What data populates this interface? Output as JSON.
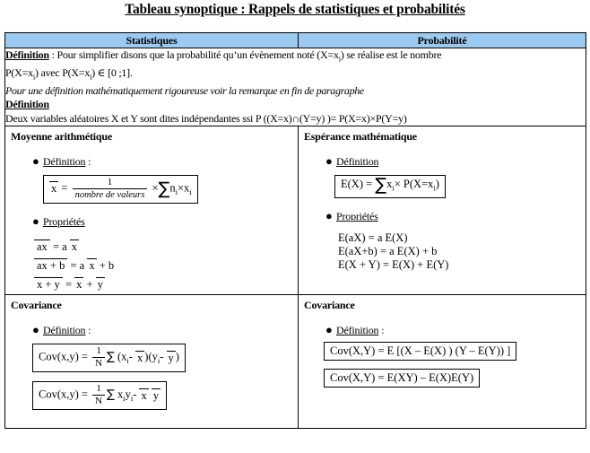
{
  "title": "Tableau synoptique : Rappels de statistiques et probabilités",
  "header": {
    "left": "Statistiques",
    "right": "Probabilité"
  },
  "definition_block": {
    "label_1": "Définition",
    "label_1_sep": " : ",
    "line_1": "Pour simplifier disons que la probabilité qu’un évènement noté (X=x",
    "line_1_sub": "i",
    "line_1_end": ") se réalise est le nombre",
    "line_2_a": "P(X=x",
    "line_2_sub1": "i",
    "line_2_b": ") avec P(X=x",
    "line_2_sub2": "i",
    "line_2_c": ") ∈ [0 ;1].",
    "remark": "Pour une définition mathématiquement rigoureuse voir la remarque en fin de paragraphe",
    "label_2": "Définition",
    "line_3": "Deux variables aléatoires X et Y sont dites indépendantes ssi P ((X=x)∩(Y=y) )= P(X=x)×P(Y=y)"
  },
  "sections": {
    "mean": {
      "heading": "Moyenne arithmétique",
      "bullet_definition": "Définition",
      "bullet_definition_colon": " :",
      "bullet_properties": "Propriétés",
      "formula": {
        "lhs": "x",
        "eq": "=",
        "num": "1",
        "den": "nombre de valeurs",
        "times": "×",
        "sigma": "∑",
        "tail_n": "n",
        "tail_n_sub": "i",
        "tail_times": "×",
        "tail_x": "x",
        "tail_x_sub": "i"
      },
      "properties": [
        {
          "bar_lhs": "ax",
          "eq": "= a",
          "bar_rhs": "x",
          "tail": ""
        },
        {
          "bar_lhs": "ax + b",
          "eq": "= a",
          "bar_rhs": "x",
          "tail": "+ b"
        },
        {
          "bar_lhs": "x + y",
          "eq": "=",
          "bar_rhs": "x",
          "tail": "",
          "bar_rhs2": "y",
          "plus": "+"
        }
      ]
    },
    "expectation": {
      "heading": "Espérance mathématique",
      "bullet_definition": "Définition",
      "bullet_properties": "Propriétés",
      "formula": {
        "lhs": "E(X) =",
        "sigma": "∑",
        "x": "x",
        "x_sub": "i",
        "times": "×",
        "prob": "P(X=x",
        "prob_sub": "i",
        "prob_end": ")"
      },
      "properties": [
        "E(aX) = a E(X)",
        "E(aX+b) = a E(X) + b",
        "E(X + Y) = E(X) + E(Y)"
      ]
    },
    "covariance_left": {
      "heading": "Covariance",
      "bullet_definition": "Définition",
      "bullet_definition_colon": " :",
      "formula_1": {
        "lhs": "Cov(x,y) =",
        "num": "1",
        "den": "N",
        "sigma": "∑",
        "open": "(x",
        "x_sub": "i",
        "minus1": "-",
        "bar_x": "x",
        "mid": ")(y",
        "y_sub": "i",
        "minus2": "-",
        "bar_y": "y",
        "close": ")"
      },
      "formula_2": {
        "lhs": "Cov(x,y) =",
        "num": "1",
        "den": "N",
        "sigma": "∑",
        "terms": "x",
        "terms_sub1": "i",
        "terms_y": "y",
        "terms_sub2": "i",
        "minus": "-",
        "bar_x": "x",
        "bar_y": "y"
      }
    },
    "covariance_right": {
      "heading": "Covariance",
      "bullet_definition": "Définition",
      "bullet_definition_colon": " :",
      "formula_1": "Cov(X,Y) = E [(X – E(X) ) (Y – E(Y)) ]",
      "formula_2": "Cov(X,Y) = E(XY) – E(X)E(Y)"
    }
  },
  "colors": {
    "header_blue": "#9CC9F0",
    "border": "#000000",
    "text": "#000000"
  }
}
